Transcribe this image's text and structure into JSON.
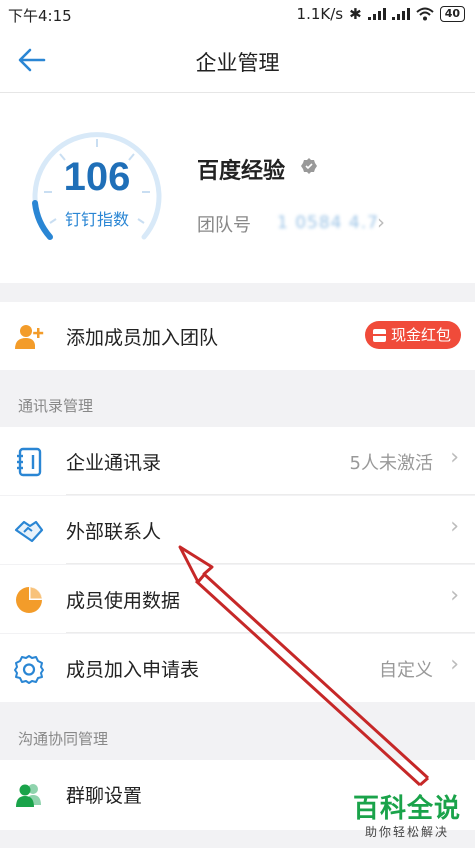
{
  "status": {
    "time": "下午4:15",
    "speed": "1.1K/s",
    "battery": "40"
  },
  "nav": {
    "title": "企业管理"
  },
  "header": {
    "score": "106",
    "score_label": "钉钉指数",
    "org_name": "百度经验",
    "team_label": "团队号",
    "team_id": "1 0584 4.7"
  },
  "add_member": {
    "label": "添加成员加入团队",
    "badge": "现金红包"
  },
  "section_contacts": {
    "title": "通讯录管理"
  },
  "contacts_items": [
    {
      "label": "企业通讯录",
      "value": "5人未激活",
      "icon": "address-book-icon"
    },
    {
      "label": "外部联系人",
      "value": "",
      "icon": "handshake-icon"
    },
    {
      "label": "成员使用数据",
      "value": "",
      "icon": "pie-chart-icon"
    },
    {
      "label": "成员加入申请表",
      "value": "自定义",
      "icon": "gear-icon"
    }
  ],
  "section_collab": {
    "title": "沟通协同管理"
  },
  "collab_items": [
    {
      "label": "群聊设置",
      "icon": "group-users-icon"
    }
  ],
  "watermark": {
    "title": "百科全说",
    "subtitle": "助你轻松解决"
  },
  "colors": {
    "accent": "#2a86d4",
    "red": "#f04b3a",
    "orange": "#f39c2a",
    "green": "#1aa34a"
  }
}
